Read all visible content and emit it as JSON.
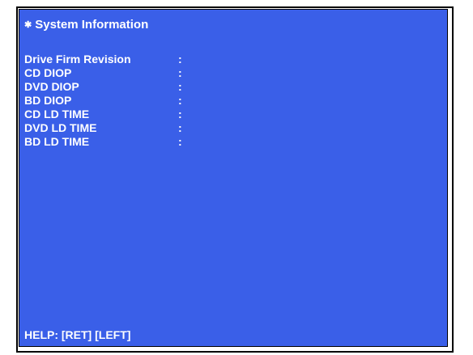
{
  "header": {
    "bullet": "✱",
    "title": "System Information"
  },
  "rows": [
    {
      "label": "Drive Firm Revision",
      "sep": ":",
      "value": ""
    },
    {
      "label": "CD DIOP",
      "sep": ":",
      "value": ""
    },
    {
      "label": "DVD DIOP",
      "sep": ":",
      "value": ""
    },
    {
      "label": "BD DIOP",
      "sep": ":",
      "value": ""
    },
    {
      "label": "CD LD TIME",
      "sep": ":",
      "value": ""
    },
    {
      "label": "DVD LD TIME",
      "sep": ":",
      "value": ""
    },
    {
      "label": "BD LD TIME",
      "sep": ":",
      "value": ""
    }
  ],
  "footer": {
    "help": "HELP: [RET] [LEFT]"
  },
  "colors": {
    "screen_bg": "#3a5fe8",
    "text": "#ffffff"
  }
}
